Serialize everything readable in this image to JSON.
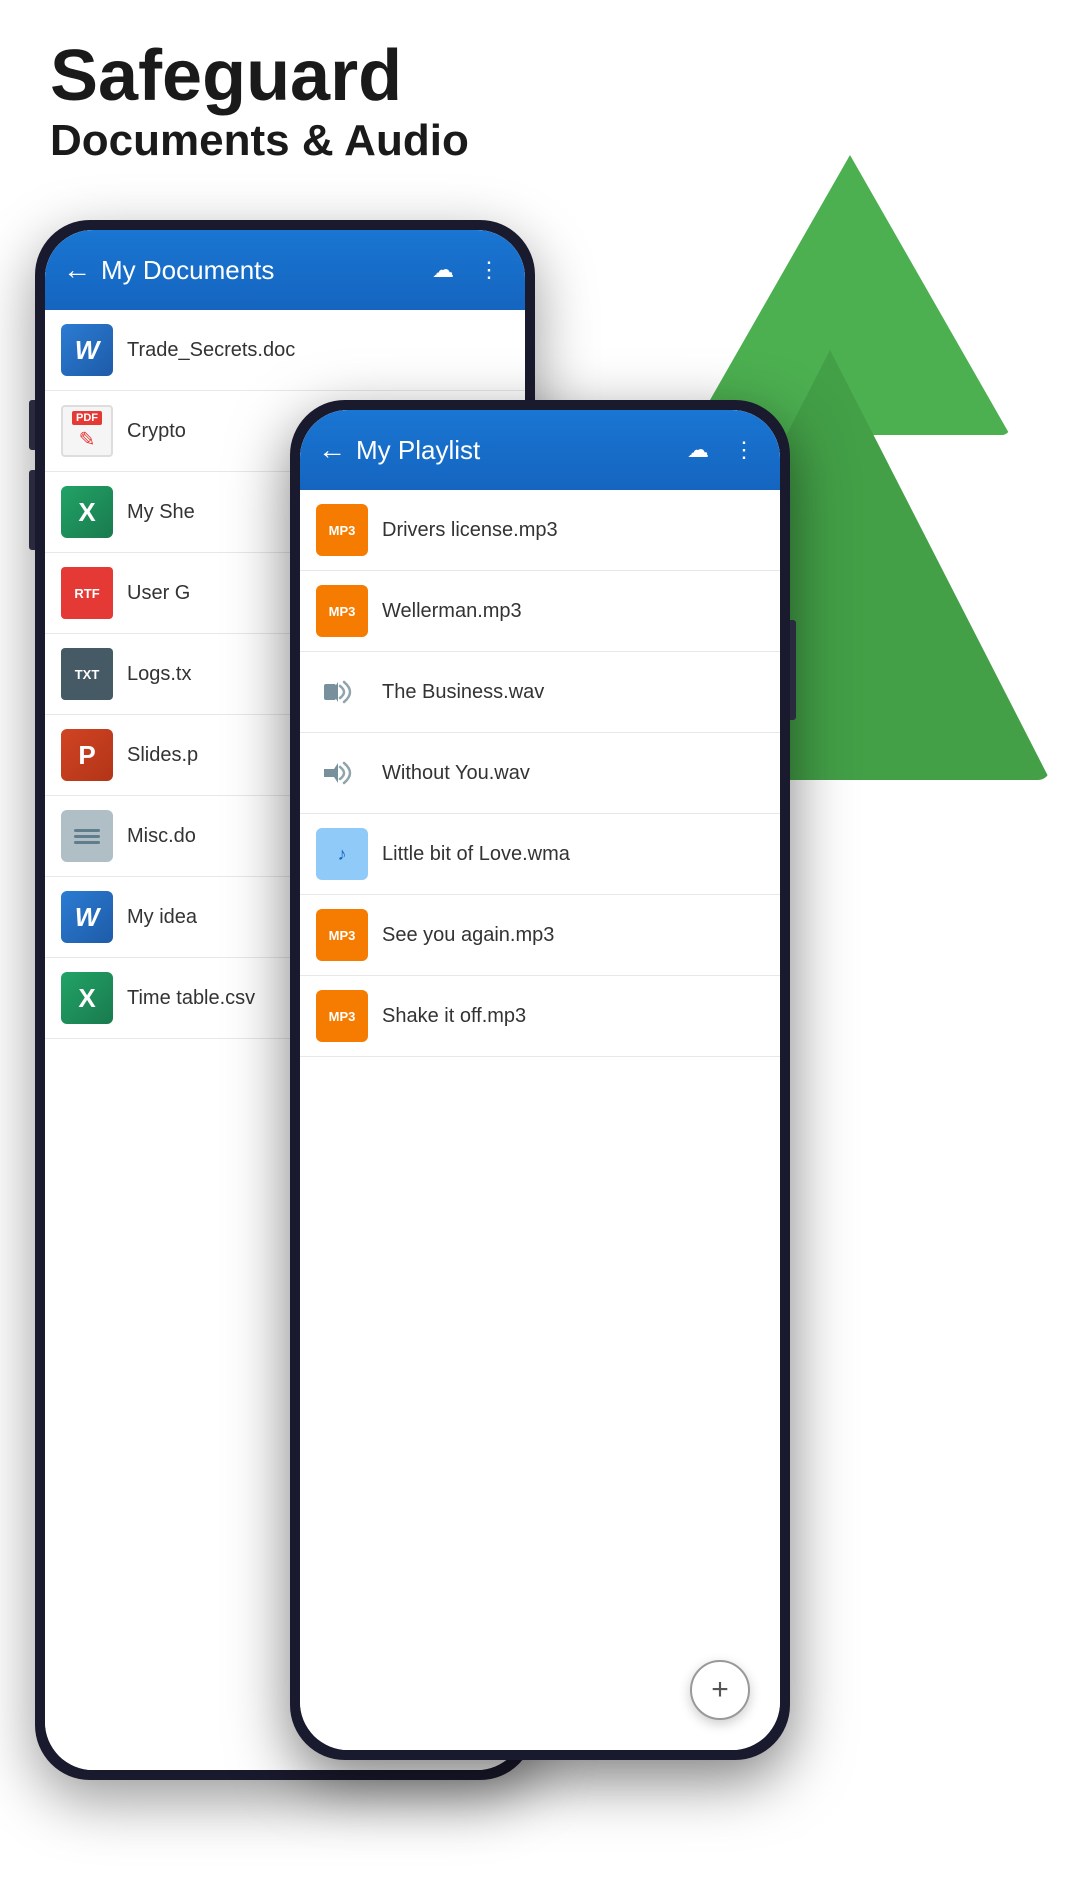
{
  "header": {
    "title": "Safeguard",
    "subtitle": "Documents & Audio"
  },
  "phone_back": {
    "app_bar": {
      "title": "My Documents",
      "back_label": "←",
      "cloud_icon": "☁",
      "menu_icon": "⋮"
    },
    "files": [
      {
        "icon": "word",
        "name": "Trade_Secrets.doc"
      },
      {
        "icon": "pdf",
        "name": "Crypto"
      },
      {
        "icon": "excel",
        "name": "My She"
      },
      {
        "icon": "rtf",
        "name": "User G"
      },
      {
        "icon": "txt",
        "name": "Logs.tx"
      },
      {
        "icon": "ppt",
        "name": "Slides.p"
      },
      {
        "icon": "doc",
        "name": "Misc.do"
      },
      {
        "icon": "word",
        "name": "My idea"
      },
      {
        "icon": "excel_green",
        "name": "Time table.csv"
      }
    ]
  },
  "phone_front": {
    "app_bar": {
      "title": "My Playlist",
      "back_label": "←",
      "cloud_icon": "☁",
      "menu_icon": "⋮"
    },
    "files": [
      {
        "icon": "mp3",
        "name": "Drivers license.mp3"
      },
      {
        "icon": "mp3",
        "name": "Wellerman.mp3"
      },
      {
        "icon": "wav",
        "name": "The Business.wav"
      },
      {
        "icon": "wav",
        "name": "Without You.wav"
      },
      {
        "icon": "wma",
        "name": "Little bit of Love.wma"
      },
      {
        "icon": "mp3",
        "name": "See you again.mp3"
      },
      {
        "icon": "mp3",
        "name": "Shake it off.mp3"
      }
    ],
    "fab": "+"
  }
}
